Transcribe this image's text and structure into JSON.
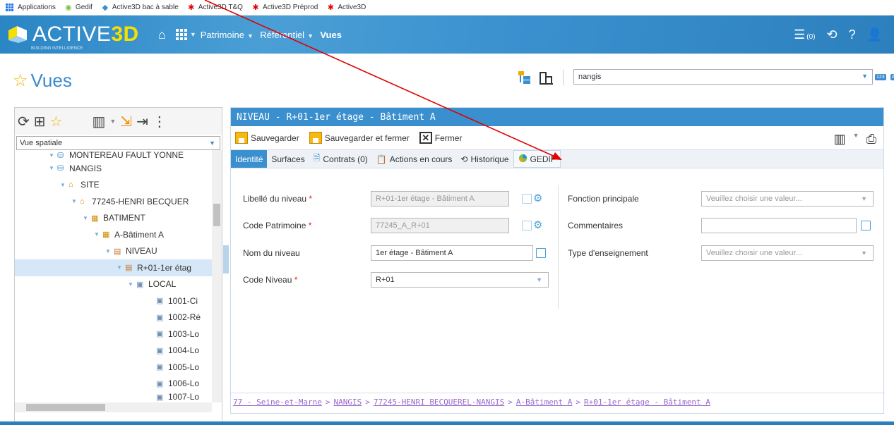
{
  "bookmarks": [
    {
      "label": "Applications",
      "icon": "apps-grid-icon"
    },
    {
      "label": "Gedif",
      "icon": "gedif-icon"
    },
    {
      "label": "Active3D bac à sable",
      "icon": "active3d-icon"
    },
    {
      "label": "Active3D T&Q",
      "icon": "red-star-icon"
    },
    {
      "label": "Active3D Préprod",
      "icon": "red-star-icon"
    },
    {
      "label": "Active3D",
      "icon": "red-star-icon"
    }
  ],
  "topbar": {
    "logo": "ACTIVE",
    "logo_accent": "3D",
    "logo_sub": "BUILDING INTELLIGENCE",
    "menu": [
      "Patrimoine",
      "Référentiel",
      "Vues"
    ],
    "cart_count": "(0)"
  },
  "page": {
    "title": "Vues",
    "search_value": "nangis",
    "badge_123": "123",
    "badge_ab": "AB"
  },
  "left": {
    "view_select": "Vue spatiale",
    "tree": [
      {
        "label": "MONTEREAU FAULT YONNE",
        "indent": 60,
        "icon": "commune",
        "cut": true
      },
      {
        "label": "NANGIS",
        "indent": 60,
        "icon": "commune"
      },
      {
        "label": "SITE",
        "indent": 76,
        "icon": "site"
      },
      {
        "label": "77245-HENRI BECQUER",
        "indent": 92,
        "icon": "site"
      },
      {
        "label": "BATIMENT",
        "indent": 108,
        "icon": "building"
      },
      {
        "label": "A-Bâtiment A",
        "indent": 124,
        "icon": "building"
      },
      {
        "label": "NIVEAU",
        "indent": 140,
        "icon": "level"
      },
      {
        "label": "R+01-1er étag",
        "indent": 156,
        "icon": "level",
        "selected": true
      },
      {
        "label": "LOCAL",
        "indent": 172,
        "icon": "room"
      },
      {
        "label": "1001-Ci",
        "indent": 200,
        "icon": "room"
      },
      {
        "label": "1002-Ré",
        "indent": 200,
        "icon": "room"
      },
      {
        "label": "1003-Lo",
        "indent": 200,
        "icon": "room"
      },
      {
        "label": "1004-Lo",
        "indent": 200,
        "icon": "room"
      },
      {
        "label": "1005-Lo",
        "indent": 200,
        "icon": "room"
      },
      {
        "label": "1006-Lo",
        "indent": 200,
        "icon": "room"
      },
      {
        "label": "1007-Lo",
        "indent": 200,
        "icon": "room",
        "cut": true
      }
    ]
  },
  "panel": {
    "header": "NIVEAU - R+01-1er étage - Bâtiment A",
    "save": "Sauvegarder",
    "save_close": "Sauvegarder et fermer",
    "close": "Fermer",
    "tabs": [
      "Identité",
      "Surfaces",
      "Contrats (0)",
      "Actions en cours",
      "Historique",
      "GEDIF"
    ],
    "fields_left": [
      {
        "label": "Libellé du niveau",
        "required": true,
        "value": "R+01-1er étage - Bâtiment A",
        "readonly": true
      },
      {
        "label": "Code Patrimoine",
        "required": true,
        "value": "77245_A_R+01",
        "readonly": true
      },
      {
        "label": "Nom du niveau",
        "required": false,
        "value": "1er étage - Bâtiment A",
        "readonly": false
      },
      {
        "label": "Code Niveau",
        "required": true,
        "value": "R+01",
        "select": true
      }
    ],
    "fields_right": [
      {
        "label": "Fonction principale",
        "value": "Veuillez choisir une valeur...",
        "select": true
      },
      {
        "label": "Commentaires",
        "value": "",
        "select": false
      },
      {
        "label": "Type d'enseignement",
        "value": "Veuillez choisir une valeur...",
        "select": true
      }
    ],
    "required_mark": "*",
    "breadcrumb": {
      "first": "77 - Seine-et-Marne",
      "links": [
        "NANGIS",
        "77245-HENRI BECQUEREL-NANGIS",
        "A-Bâtiment A",
        "R+01-1er étage - Bâtiment A"
      ],
      "sep": ">"
    }
  },
  "colors": {
    "brand": "#3a8fce",
    "accent": "#f7e000",
    "arrow": "#e00000"
  }
}
